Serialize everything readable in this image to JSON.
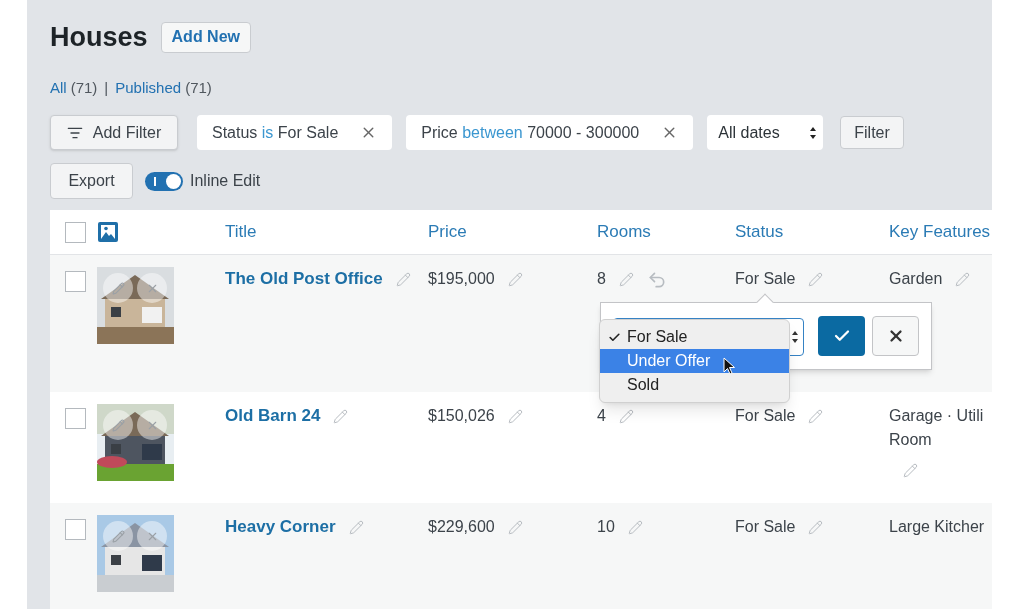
{
  "page_title": "Houses",
  "add_new": "Add New",
  "views": [
    {
      "label": "All",
      "count": "(71)"
    },
    {
      "label": "Published",
      "count": "(71)"
    }
  ],
  "view_separator": "|",
  "add_filter": "Add Filter",
  "filter_chips": [
    {
      "field": "Status",
      "operator": "is",
      "value": "For Sale"
    },
    {
      "field": "Price",
      "operator": "between",
      "value": "70000 - 300000"
    }
  ],
  "date_select": "All dates",
  "filter_button": "Filter",
  "export_button": "Export",
  "inline_edit": {
    "label": "Inline Edit",
    "on": true
  },
  "select_all_checked": false,
  "columns": [
    "Title",
    "Price",
    "Rooms",
    "Status",
    "Key Features"
  ],
  "rows": [
    {
      "checked": false,
      "title": "The Old Post Office",
      "price": "$195,000",
      "rooms": "8",
      "rooms_undo": true,
      "status": "For Sale",
      "features": [
        "Garden"
      ],
      "features_edit_icon": true,
      "status_editor": {
        "options": [
          {
            "label": "For Sale",
            "selected": true,
            "hovered": false
          },
          {
            "label": "Under Offer",
            "selected": false,
            "hovered": true
          },
          {
            "label": "Sold",
            "selected": false,
            "hovered": false
          }
        ]
      }
    },
    {
      "checked": false,
      "title": "Old Barn 24",
      "price": "$150,026",
      "rooms": "4",
      "rooms_undo": false,
      "status": "For Sale",
      "features": [
        "Garage · Utili",
        "Room"
      ],
      "features_edit_icon": true
    },
    {
      "checked": false,
      "title": "Heavy Corner",
      "price": "$229,600",
      "rooms": "10",
      "rooms_undo": false,
      "status": "For Sale",
      "features": [
        "Large Kitcher"
      ],
      "features_edit_icon": false
    }
  ]
}
